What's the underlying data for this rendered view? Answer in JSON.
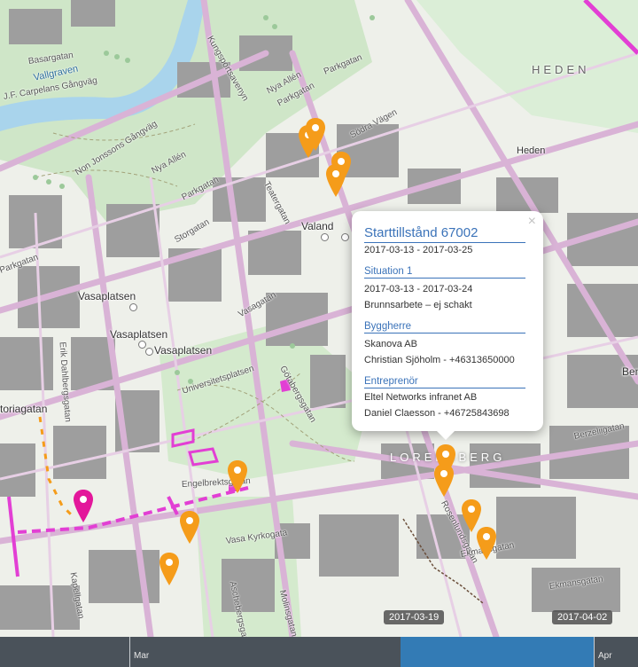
{
  "map": {
    "districts": [
      "HEDEN",
      "LORENSBERG"
    ],
    "place_labels": [
      "Heden",
      "Valand",
      "Vasaplatsen",
      "Vasaplatsen",
      "Vasaplatsen",
      "Ben",
      "toriagatan"
    ],
    "streets": [
      "Basargatan",
      "Vallgraven",
      "J.F. Carpelans Gångväg",
      "Non Jonssons Gångväg",
      "Nya Allén",
      "Nya Allén",
      "Parkgatan",
      "Parkgatan",
      "Parkgatan",
      "Parkgatan",
      "Södra Vägen",
      "Engelbrektsgatan",
      "Vasa Kyrkogata",
      "Molinsgatan",
      "Ekmansgatan",
      "Berzeliigatan",
      "Erik Dahlbergsgatan",
      "Universitetsplatsen",
      "Storgatan",
      "Vasagatan",
      "Götabergsgatan",
      "Teatergatan",
      "Kungsportsavenyn",
      "Aschebergsgatan",
      "Kapellgatan",
      "Rosenlundsgatan",
      "Ekmansgatan"
    ],
    "colors": {
      "pin_orange": "#f59c1a",
      "pin_magenta": "#e3179b",
      "route": "#e23fd4",
      "popup_accent": "#3b73b9"
    }
  },
  "popup": {
    "title": "Starttillstånd 67002",
    "period": "2017-03-13 - 2017-03-25",
    "situation_heading": "Situation 1",
    "situation_period": "2017-03-13 - 2017-03-24",
    "situation_type": "Brunnsarbete – ej schakt",
    "owner_heading": "Byggherre",
    "owner_company": "Skanova AB",
    "owner_contact": "Christian Sjöholm - +46313650000",
    "contractor_heading": "Entreprenör",
    "contractor_company": "Eltel Networks infranet AB",
    "contractor_contact": "Daniel Claesson - +46725843698",
    "close_symbol": "×"
  },
  "timeline": {
    "start_badge": "2017-03-19",
    "end_badge": "2017-04-02",
    "month_labels": [
      "Mar",
      "Apr"
    ]
  }
}
